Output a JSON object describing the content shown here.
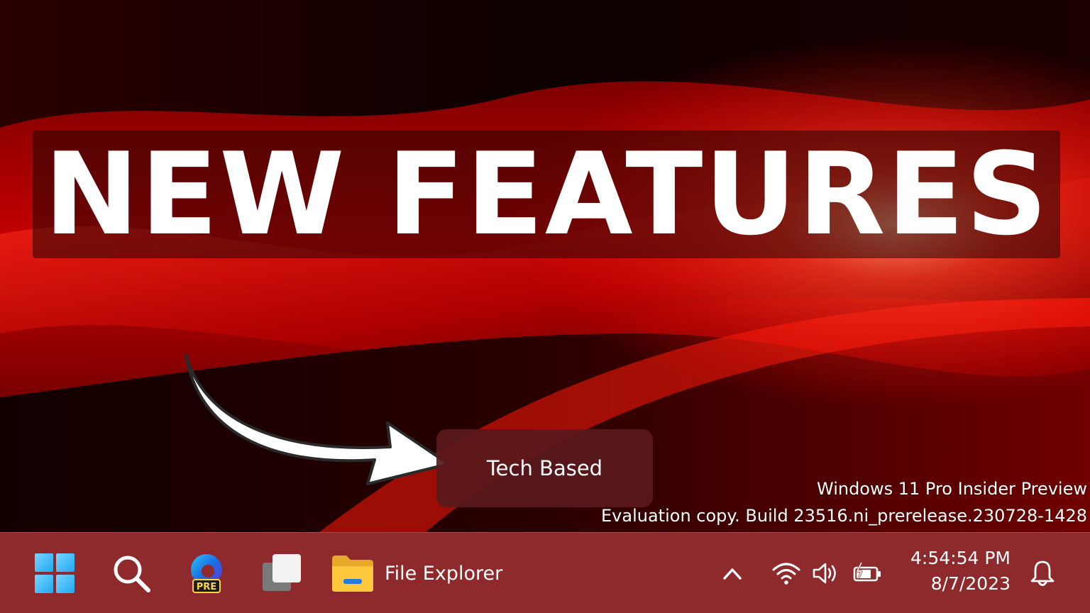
{
  "desktop": {
    "headline": "NEW FEATURES",
    "tooltip": "Tech Based",
    "watermark": {
      "line1": "Windows 11 Pro Insider Preview",
      "line2": "Evaluation copy. Build 23516.ni_prerelease.230728-1428"
    }
  },
  "taskbar": {
    "items": [
      {
        "name": "start",
        "icon": "windows-logo-icon"
      },
      {
        "name": "search",
        "icon": "search-icon"
      },
      {
        "name": "edge-preview",
        "icon": "edge-icon",
        "badge": "PRE"
      },
      {
        "name": "task-view",
        "icon": "task-view-icon"
      },
      {
        "name": "file-explorer",
        "icon": "folder-icon",
        "label": "File Explorer"
      }
    ],
    "tray": {
      "icons": [
        "chevron-up-icon",
        "wifi-icon",
        "volume-icon",
        "battery-charging-icon"
      ],
      "time": "4:54:54 PM",
      "date": "8/7/2023",
      "notification_icon": "bell-icon"
    }
  },
  "colors": {
    "taskbar_bg": "#8e2a2c",
    "wallpaper_red": "#e30000",
    "wallpaper_dark": "#1a0000",
    "windows_logo": "#4cc2ff",
    "folder_yellow": "#ffc83d"
  }
}
